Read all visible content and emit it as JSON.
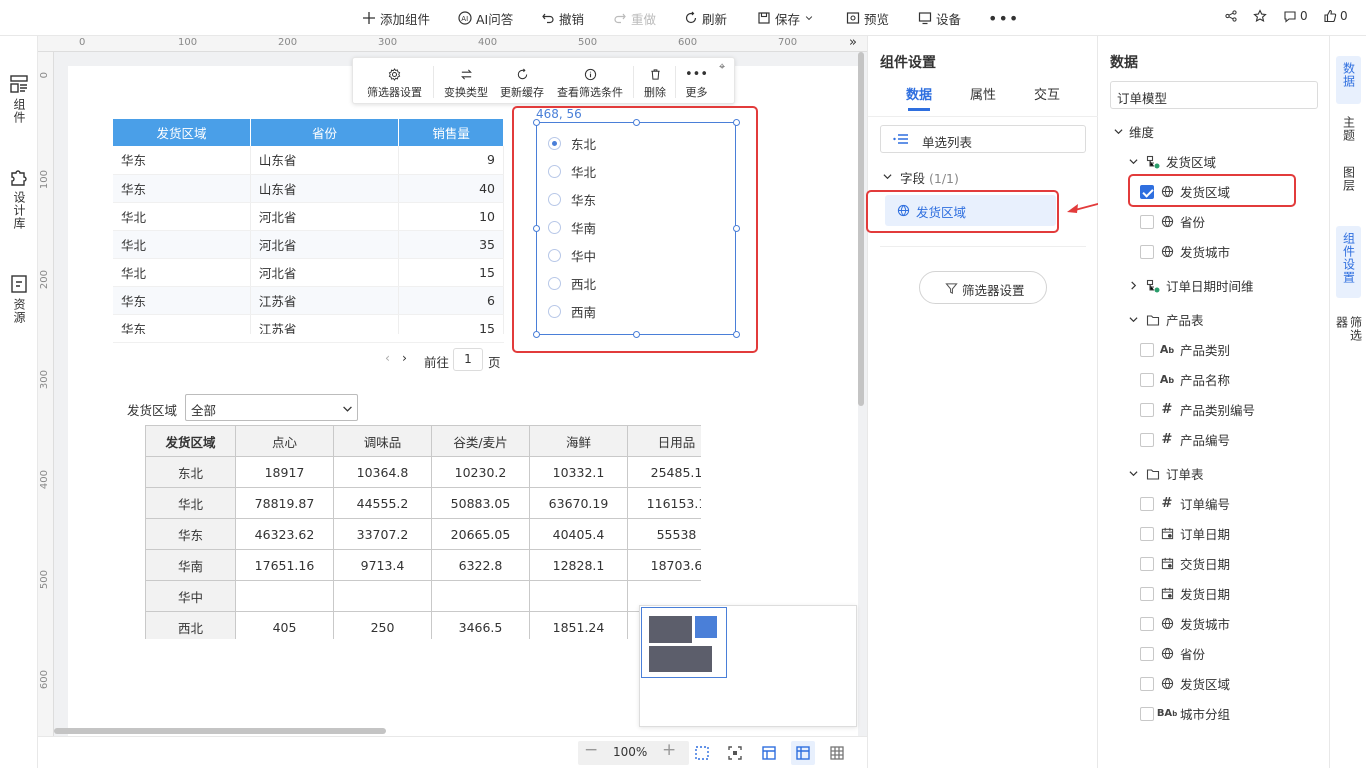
{
  "topbar": {
    "add_component": "添加组件",
    "ai_qa": "AI问答",
    "undo": "撤销",
    "redo": "重做",
    "refresh": "刷新",
    "save": "保存",
    "preview": "预览",
    "device": "设备",
    "comments_count": "0",
    "likes_count": "0"
  },
  "leftbar": {
    "components": "组件",
    "design_library": "设计库",
    "resources": "资源"
  },
  "ruler": {
    "top": [
      "0",
      "100",
      "200",
      "300",
      "400",
      "500",
      "600",
      "700"
    ],
    "left": [
      "0",
      "100",
      "200",
      "300",
      "400",
      "500",
      "600"
    ]
  },
  "table1": {
    "headers": [
      "发货区域",
      "省份",
      "销售量"
    ],
    "rows": [
      [
        "华东",
        "山东省",
        "9"
      ],
      [
        "华东",
        "山东省",
        "40"
      ],
      [
        "华北",
        "河北省",
        "10"
      ],
      [
        "华北",
        "河北省",
        "35"
      ],
      [
        "华北",
        "河北省",
        "15"
      ],
      [
        "华东",
        "江苏省",
        "6"
      ],
      [
        "华东",
        "江苏省",
        "15"
      ]
    ]
  },
  "pagination": {
    "goto": "前往",
    "page": "1",
    "unit": "页"
  },
  "comp_toolbar": {
    "filter_settings": "筛选器设置",
    "switch_type": "变换类型",
    "update_cache": "更新缓存",
    "view_conditions": "查看筛选条件",
    "delete": "删除",
    "more": "更多"
  },
  "filter_widget": {
    "coords": "468, 56",
    "options": [
      "东北",
      "华北",
      "华东",
      "华南",
      "华中",
      "西北",
      "西南"
    ],
    "selected": "东北"
  },
  "select_filter": {
    "label": "发货区域",
    "value": "全部"
  },
  "table2": {
    "headers": [
      "发货区域",
      "点心",
      "调味品",
      "谷类/麦片",
      "海鲜",
      "日用品"
    ],
    "rows": [
      [
        "东北",
        "18917",
        "10364.8",
        "10230.2",
        "10332.1",
        "25485.1"
      ],
      [
        "华北",
        "78819.87",
        "44555.2",
        "50883.05",
        "63670.19",
        "116153.1"
      ],
      [
        "华东",
        "46323.62",
        "33707.2",
        "20665.05",
        "40405.4",
        "55538"
      ],
      [
        "华南",
        "17651.16",
        "9713.4",
        "6322.8",
        "12828.1",
        "18703.6"
      ],
      [
        "华中",
        "",
        "",
        "",
        "",
        ""
      ],
      [
        "西北",
        "405",
        "250",
        "3466.5",
        "1851.24",
        ""
      ]
    ]
  },
  "zoom": {
    "level": "100%"
  },
  "settings": {
    "title": "组件设置",
    "tabs": [
      "数据",
      "属性",
      "交互"
    ],
    "active_tab": "数据",
    "type": "单选列表",
    "fields_label": "字段",
    "fields_count": "(1/1)",
    "field_item": "发货区域",
    "filter_button": "筛选器设置"
  },
  "datapanel": {
    "title": "数据",
    "model": "订单模型",
    "dimension": "维度",
    "groups": [
      {
        "name": "发货区域",
        "items": [
          {
            "label": "发货区域",
            "checked": true,
            "icon": "globe"
          },
          {
            "label": "省份",
            "icon": "globe"
          },
          {
            "label": "发货城市",
            "icon": "globe"
          }
        ]
      },
      {
        "name": "订单日期时间维"
      },
      {
        "name": "产品表",
        "items": [
          {
            "label": "产品类别",
            "icon": "text"
          },
          {
            "label": "产品名称",
            "icon": "text"
          },
          {
            "label": "产品类别编号",
            "icon": "hash"
          },
          {
            "label": "产品编号",
            "icon": "hash"
          }
        ]
      },
      {
        "name": "订单表",
        "items": [
          {
            "label": "订单编号",
            "icon": "hash"
          },
          {
            "label": "订单日期",
            "icon": "date"
          },
          {
            "label": "交货日期",
            "icon": "date"
          },
          {
            "label": "发货日期",
            "icon": "date"
          },
          {
            "label": "发货城市",
            "icon": "globe"
          },
          {
            "label": "省份",
            "icon": "globe"
          },
          {
            "label": "发货区域",
            "icon": "globe"
          },
          {
            "label": "城市分组",
            "icon": "group"
          }
        ]
      }
    ]
  },
  "rightrail": {
    "items": [
      "数据",
      "主题",
      "图层",
      "组件设置",
      "筛选器"
    ],
    "active": [
      "数据",
      "组件设置"
    ]
  },
  "colors": {
    "accent": "#2f6fdf",
    "header_blue": "#4a9fe8",
    "highlight_red": "#e23b3b"
  }
}
